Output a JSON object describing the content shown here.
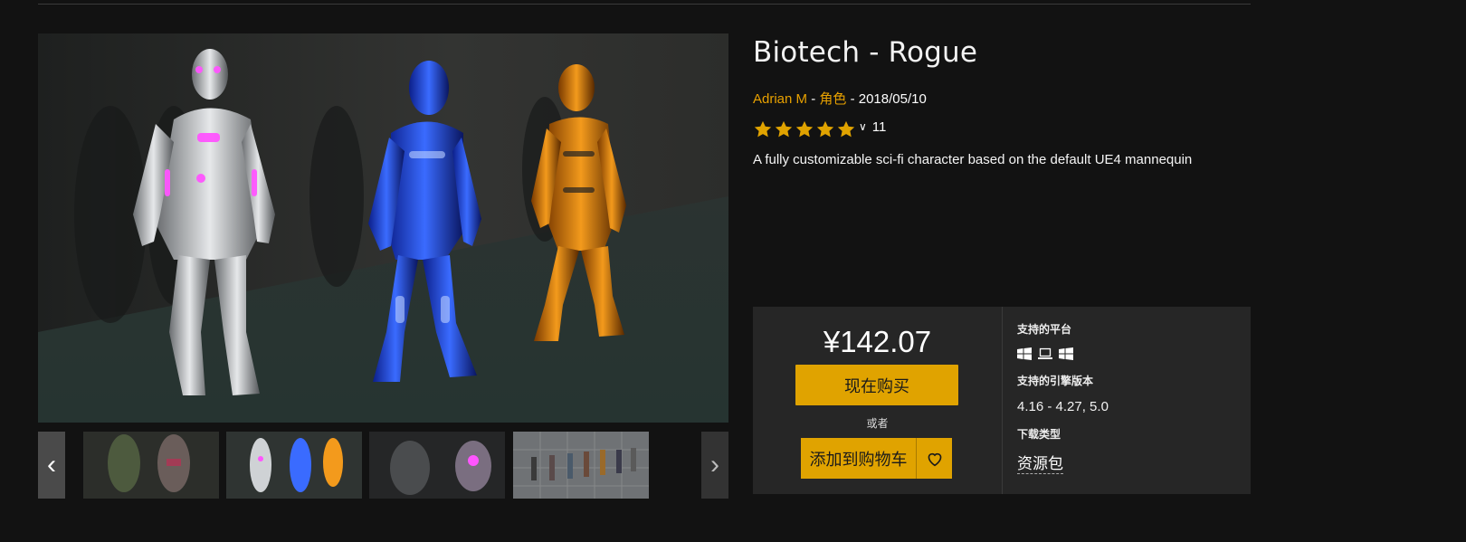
{
  "product": {
    "title": "Biotech - Rogue",
    "author": "Adrian M",
    "separator": "-",
    "category": "角色",
    "date": "2018/05/10",
    "rating_stars": 5,
    "rating_count": "11",
    "description": "A fully customizable sci-fi character based on the default UE4 mannequin"
  },
  "purchase": {
    "price": "¥142.07",
    "buy_label": "现在购买",
    "or_label": "或者",
    "cart_label": "添加到购物车"
  },
  "specs": {
    "platforms_label": "支持的平台",
    "platform_icons": [
      "windows-icon",
      "laptop-icon",
      "windows-icon"
    ],
    "engine_label": "支持的引擎版本",
    "engine_value": "4.16 - 4.27, 5.0",
    "download_label": "下载类型",
    "download_value": "资源包"
  },
  "gallery": {
    "prev_icon": "chevron-left-icon",
    "next_icon": "chevron-right-icon",
    "thumbnails": [
      "thumbnail-1",
      "thumbnail-2",
      "thumbnail-3",
      "thumbnail-4"
    ]
  },
  "colors": {
    "accent": "#e0a300",
    "author_link": "#e8a100",
    "background": "#121212",
    "panel": "#262626"
  }
}
